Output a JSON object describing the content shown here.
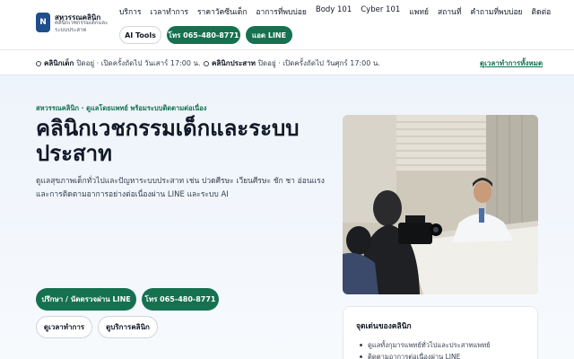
{
  "brand": {
    "logo_letter": "N",
    "name": "สหวรรณคลินิก",
    "tagline": "คลินิกเวชกรรมเด็กและระบบประสาท"
  },
  "nav": {
    "items": [
      "บริการ",
      "เวลาทำการ",
      "ราคาวัคซีนเด็ก",
      "อาการที่พบบ่อย",
      "Body 101",
      "Cyber 101",
      "แพทย์",
      "สถานที่",
      "คำถามที่พบบ่อย",
      "ติดต่อ"
    ]
  },
  "header_buttons": {
    "ai_tools": "AI Tools",
    "call": "โทร 065-480-8771",
    "line": "แอด LINE"
  },
  "status": {
    "kids": {
      "label": "คลินิกเด็ก",
      "text": "ปิดอยู่ · เปิดครั้งถัดไป วันเสาร์ 17:00 น."
    },
    "neuro": {
      "label": "คลินิกประสาท",
      "text": "ปิดอยู่ · เปิดครั้งถัดไป วันศุกร์ 17:00 น."
    },
    "all_hours_link": "ดูเวลาทำการทั้งหมด"
  },
  "hero": {
    "eyebrow": "สหวรรณคลินิก · ดูแลโดยแพทย์ พร้อมระบบติดตามต่อเนื่อง",
    "title": "คลินิกเวชกรรมเด็กและระบบประสาท",
    "description": "ดูแลสุขภาพเด็กทั่วไปและปัญหาระบบประสาท เช่น ปวดศีรษะ เวียนศีรษะ ชัก ชา อ่อนแรง และการติดตามอาการอย่างต่อเนื่องผ่าน LINE และระบบ AI",
    "buttons": {
      "appointment": "ปรึกษา / นัดตรวจผ่าน LINE",
      "call": "โทร 065-480-8771",
      "hours": "ดูเวลาทำการ",
      "services": "ดูบริการคลินิก"
    }
  },
  "highlights": {
    "title": "จุดเด่นของคลินิก",
    "items": [
      "ดูแลทั้งกุมารแพทย์ทั่วไปและประสาทแพทย์",
      "ติดตามอาการต่อเนื่องผ่าน LINE"
    ]
  },
  "colors": {
    "accent": "#15714f",
    "brand_logo": "#1f4e8c",
    "hero_bg": "#eef4fb"
  }
}
